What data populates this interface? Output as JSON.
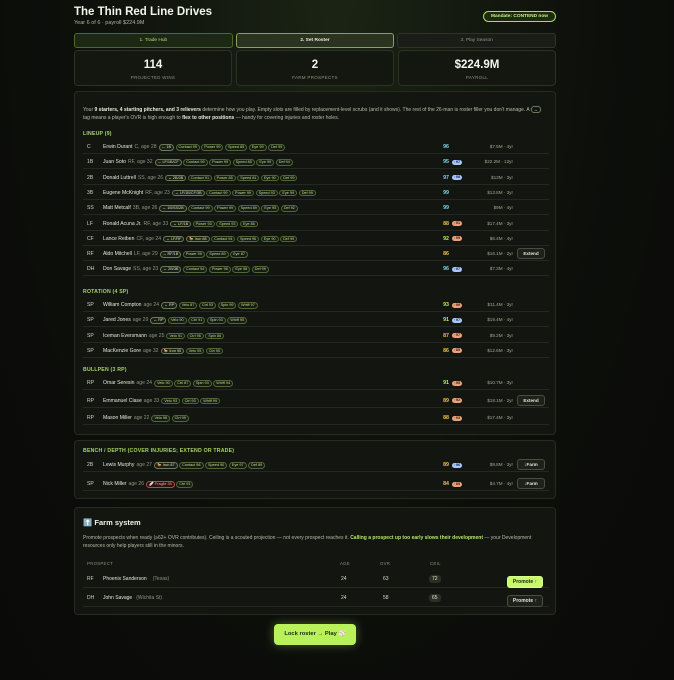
{
  "title": "The Thin Red Line Drives",
  "subtitle": "Year 6 of 6 · payroll $224.9M",
  "mandate": "Mandate: CONTEND now",
  "tabs": [
    "1. Trade Hub",
    "2. Set Roster",
    "3. Play Season"
  ],
  "stats": [
    {
      "value": "114",
      "label": "PROJECTED WINS"
    },
    {
      "value": "2",
      "label": "FARM PROSPECTS"
    },
    {
      "value": "$224.9M",
      "label": "PAYROLL"
    }
  ],
  "intro": {
    "p1": "Your ",
    "b1": "9 starters, 4 starting pitchers, and 3 relievers",
    "p2": " determine how you play. Empty slots are filled by replacement-level scrubs (and it shows). The rest of the 26-man is roster filler you don't manage. A ",
    "kbd": "↔",
    "p3": " tag means a player's OVR is high enough to ",
    "b2": "flex to other positions",
    "p4": " — handy for covering injuries and roster holes."
  },
  "sections": {
    "lineup": "LINEUP (9)",
    "rotation": "ROTATION (4 SP)",
    "bullpen": "BULLPEN (3 RP)",
    "bench": "BENCH / DEPTH (COVER INJURIES; EXTEND OR TRADE)"
  },
  "lineup": [
    {
      "pos": "C",
      "name": "Erwin Durant",
      "age": "C, age 28",
      "tags": [
        "↔ 1B"
      ],
      "chips": [
        "Contact 99",
        "Power 99",
        "Speed 85",
        "Eye 99",
        "Def 99"
      ],
      "ovr": "96",
      "delta": "",
      "contract": "$7.5M · 4yr",
      "action": ""
    },
    {
      "pos": "1B",
      "name": "Juan Soto",
      "age": "RF, age 32",
      "tags": [
        "↔ LF/1B/CF"
      ],
      "chips": [
        "Contact 99",
        "Power 99",
        "Speed 85",
        "Eye 99",
        "Def 94"
      ],
      "ovr": "95",
      "delta": "↑97",
      "contract": "$22.2M · 13yr",
      "action": ""
    },
    {
      "pos": "2B",
      "name": "Donald Luttrell",
      "age": "SS, age 26",
      "tags": [
        "↔ 2B/3B"
      ],
      "chips": [
        "Contact 91",
        "Power 85",
        "Speed 81",
        "Eye 90",
        "Def 99"
      ],
      "ovr": "97",
      "delta": "↑98",
      "contract": "$13M · 3yr",
      "action": ""
    },
    {
      "pos": "3B",
      "name": "Eugene McKnight",
      "age": "RF, age 23",
      "tags": [
        "↔ LF/1B/CF/3B"
      ],
      "chips": [
        "Contact 99",
        "Power 99",
        "Speed 93",
        "Eye 99",
        "Def 99"
      ],
      "ovr": "99",
      "delta": "",
      "contract": "$13.8M · 3yr",
      "action": ""
    },
    {
      "pos": "SS",
      "name": "Matt Metcalf",
      "age": "3B, age 26",
      "tags": [
        "↔ 1B/SS/2B"
      ],
      "chips": [
        "Contact 99",
        "Power 99",
        "Speed 89",
        "Eye 95",
        "Def 92"
      ],
      "ovr": "99",
      "delta": "",
      "contract": "$9M · 4yr",
      "action": ""
    },
    {
      "pos": "LF",
      "name": "Ronald Acuna Jr.",
      "age": "RF, age 33",
      "tags": [
        "↔ LF/1B"
      ],
      "chips": [
        "Power 93",
        "Speed 93",
        "Eye 88"
      ],
      "ovr": "88",
      "delta": "↑91",
      "contract": "$17.4M · 3yr",
      "action": ""
    },
    {
      "pos": "CF",
      "name": "Lance Reiben",
      "age": "CF, age 24",
      "tags": [
        "↔ LF/RF",
        "🐎 Iron 88"
      ],
      "chips": [
        "Contact 94",
        "Speed 96",
        "Eye 90",
        "Def 99"
      ],
      "ovr": "92",
      "delta": "↑99",
      "contract": "$6.4M · 4yr",
      "action": ""
    },
    {
      "pos": "RF",
      "name": "Aldo Mitchell",
      "age": "LF, age 29",
      "tags": [
        "↔ RF/1B"
      ],
      "chips": [
        "Power 99",
        "Speed 89",
        "Eye 87"
      ],
      "ovr": "86",
      "delta": "",
      "contract": "$16.1M · 2yr",
      "action": "Extend"
    },
    {
      "pos": "DH",
      "name": "Don Savage",
      "age": "SS, age 23",
      "tags": [
        "↔ 2B/3B"
      ],
      "chips": [
        "Contact 94",
        "Power 96",
        "Eye 98",
        "Def 99"
      ],
      "ovr": "96",
      "delta": "↑97",
      "contract": "$7.3M · 4yr",
      "action": ""
    }
  ],
  "rotation": [
    {
      "pos": "SP",
      "name": "William Compton",
      "age": "age 24",
      "tags": [
        "↔ RP"
      ],
      "chips": [
        "Velo 87",
        "Ctrl 93",
        "Spin 99",
        "Whiff 97"
      ],
      "ovr": "93",
      "delta": "↑99",
      "contract": "$11.4M · 3yr",
      "action": ""
    },
    {
      "pos": "SP",
      "name": "Jared Jones",
      "age": "age 29",
      "tags": [
        "↔ RP"
      ],
      "chips": [
        "Velo 90",
        "Ctrl 91",
        "Spin 93",
        "Whiff 95"
      ],
      "ovr": "91",
      "delta": "↑97",
      "contract": "$19.4M · 4yr",
      "action": ""
    },
    {
      "pos": "SP",
      "name": "Iceman Eversmann",
      "age": "age 25",
      "tags": [],
      "chips": [
        "Velo 91",
        "Ctrl 96",
        "Spin 86"
      ],
      "ovr": "87",
      "delta": "↑97",
      "contract": "$9.2M · 3yr",
      "action": ""
    },
    {
      "pos": "SP",
      "name": "MacKenzie Gore",
      "age": "age 32",
      "tags": [
        "🐎 Iron 95"
      ],
      "chips": [
        "Velo 95",
        "Ctrl 95"
      ],
      "ovr": "86",
      "delta": "↑89",
      "contract": "$12.6M · 3yr",
      "action": ""
    }
  ],
  "bullpen": [
    {
      "pos": "RP",
      "name": "Omar Seresin",
      "age": "age 24",
      "tags": [],
      "chips": [
        "Velo 90",
        "Ctrl 87",
        "Spin 93",
        "Whiff 94"
      ],
      "ovr": "91",
      "delta": "↑95",
      "contract": "$10.7M · 3yr",
      "action": ""
    },
    {
      "pos": "RP",
      "name": "Emmanuel Clase",
      "age": "age 33",
      "tags": [],
      "chips": [
        "Velo 93",
        "Ctrl 93",
        "Whiff 99"
      ],
      "ovr": "89",
      "delta": "↑92",
      "contract": "$18.1M · 2yr",
      "action": "Extend"
    },
    {
      "pos": "RP",
      "name": "Mason Miller",
      "age": "age 22",
      "tags": [],
      "chips": [
        "Velo 98",
        "Ctrl 99"
      ],
      "ovr": "88",
      "delta": "↑93",
      "contract": "$17.4M · 3yr",
      "action": ""
    }
  ],
  "bench": [
    {
      "pos": "2B",
      "name": "Lewis Murphy",
      "age": "age 27",
      "tags": [
        "🐎 Iron 87"
      ],
      "chips": [
        "Contact 98",
        "Speed 90",
        "Eye 97",
        "Def 89"
      ],
      "ovr": "89",
      "delta": "↑96",
      "contract": "$9.8M · 3yr",
      "action": "↓Farm"
    },
    {
      "pos": "SP",
      "name": "Nick Miller",
      "age": "age 26",
      "tags": [
        "🩹 Fragile 35"
      ],
      "chips": [
        "Ctrl 91"
      ],
      "ovr": "84",
      "delta": "↑89",
      "contract": "$4.7M · 4yr",
      "action": "↓Farm"
    }
  ],
  "farm": {
    "title": "⬆️ Farm system",
    "note1": "Promote prospects when ready (≥62+ OVR contributes). Ceiling is a scouted projection — not every prospect reaches it. ",
    "note2": "Calling a prospect up too early slows their development",
    "note3": " — your Development resources only help players still in the minors.",
    "headers": [
      "PROSPECT",
      "AGE",
      "OVR",
      "CEIL"
    ],
    "prospects": [
      {
        "pos": "RF",
        "name": "Phoenix Sanderson",
        "team": "(Texas)",
        "age": "24",
        "ovr": "63",
        "ceil": "72",
        "action": "Promote ↑"
      },
      {
        "pos": "DH",
        "name": "John Savage",
        "team": "(Wichita St)",
        "age": "24",
        "ovr": "58",
        "ceil": "65",
        "action": "Promote ↑"
      }
    ]
  },
  "lock_button": "Lock roster → Play ⚾",
  "colors": {
    "accent": "#b9f15b",
    "ovr_green": "#7fd8f2",
    "ovr_gold": "#f0c24f"
  }
}
